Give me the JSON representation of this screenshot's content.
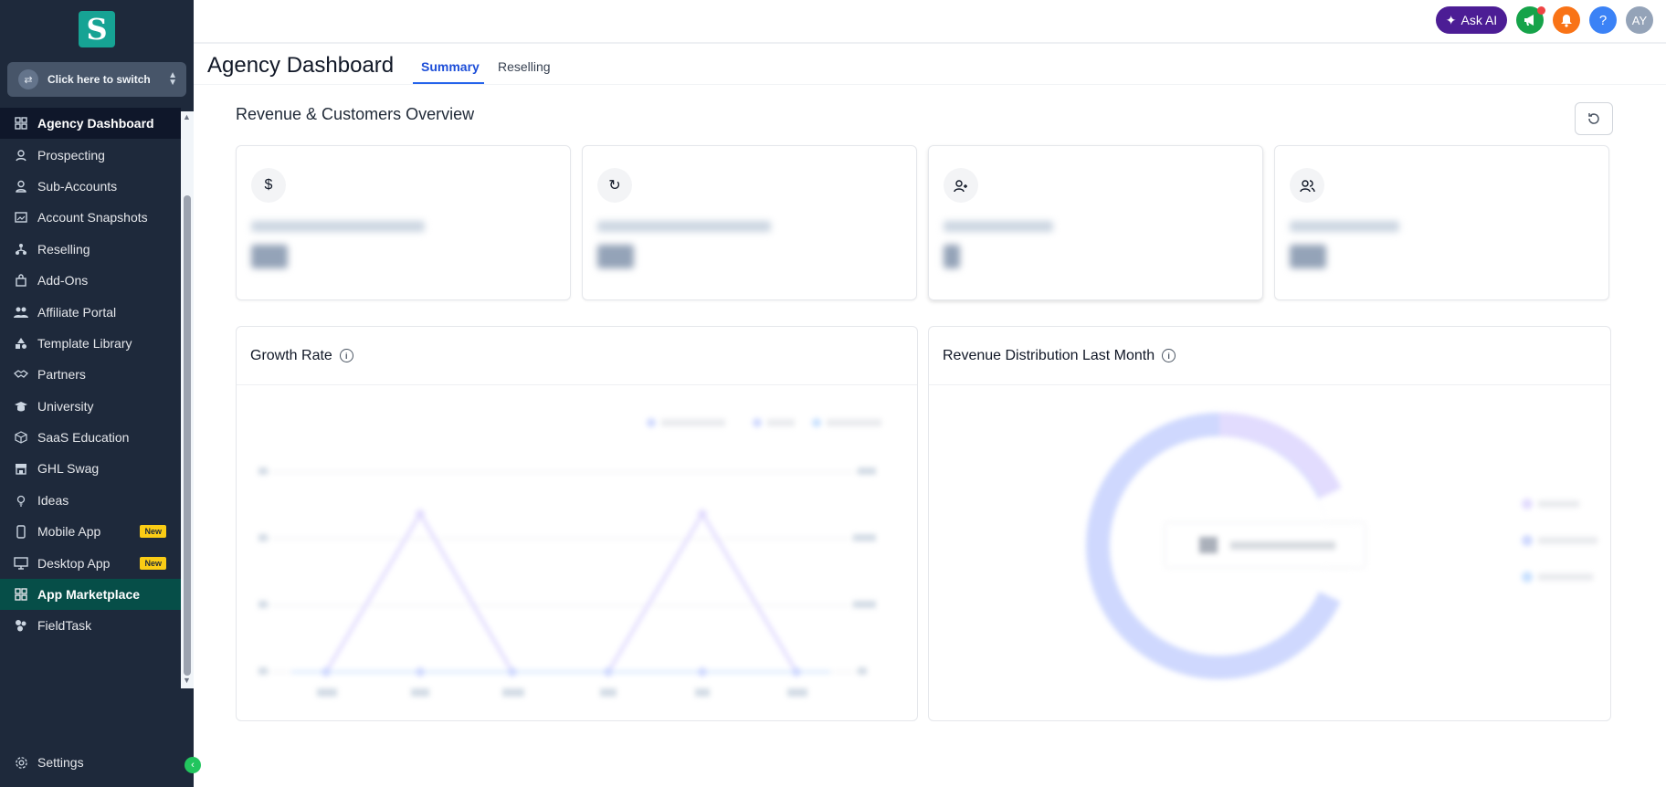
{
  "sidebar": {
    "logo_letter": "S",
    "switcher_label": "Click here to switch",
    "items": [
      {
        "label": "Agency Dashboard",
        "icon": "dashboard-icon",
        "state": "active"
      },
      {
        "label": "Prospecting",
        "icon": "prospecting-icon"
      },
      {
        "label": "Sub-Accounts",
        "icon": "user-icon"
      },
      {
        "label": "Account Snapshots",
        "icon": "snapshot-icon"
      },
      {
        "label": "Reselling",
        "icon": "reselling-icon"
      },
      {
        "label": "Add-Ons",
        "icon": "bag-icon"
      },
      {
        "label": "Affiliate Portal",
        "icon": "users-icon"
      },
      {
        "label": "Template Library",
        "icon": "shapes-icon"
      },
      {
        "label": "Partners",
        "icon": "handshake-icon"
      },
      {
        "label": "University",
        "icon": "graduation-icon"
      },
      {
        "label": "SaaS Education",
        "icon": "box-icon"
      },
      {
        "label": "GHL Swag",
        "icon": "store-icon"
      },
      {
        "label": "Ideas",
        "icon": "lightbulb-icon"
      },
      {
        "label": "Mobile App",
        "icon": "phone-icon",
        "badge": "New"
      },
      {
        "label": "Desktop App",
        "icon": "monitor-icon",
        "badge": "New"
      },
      {
        "label": "App Marketplace",
        "icon": "grid-icon",
        "state": "highlight"
      },
      {
        "label": "FieldTask",
        "icon": "fieldtask-icon"
      }
    ],
    "settings_label": "Settings"
  },
  "topbar": {
    "ask_ai_label": "Ask AI",
    "help_glyph": "?",
    "avatar_initials": "AY",
    "colors": {
      "ask_ai": "#4c1d95",
      "megaphone": "#16a34a",
      "bell": "#f97316",
      "help": "#3b82f6",
      "avatar": "#94a3b8"
    }
  },
  "page": {
    "title": "Agency Dashboard",
    "tabs": [
      {
        "label": "Summary",
        "active": true
      },
      {
        "label": "Reselling",
        "active": false
      }
    ],
    "section_title": "Revenue & Customers Overview"
  },
  "stat_cards": [
    {
      "icon": "dollar-icon",
      "glyph": "$"
    },
    {
      "icon": "recurring-icon",
      "glyph": "↻"
    },
    {
      "icon": "user-plus-icon",
      "glyph": "👤"
    },
    {
      "icon": "users-icon",
      "glyph": "👥"
    }
  ],
  "charts": {
    "growth_title": "Growth Rate",
    "distribution_title": "Revenue Distribution Last Month",
    "info_glyph": "i"
  }
}
